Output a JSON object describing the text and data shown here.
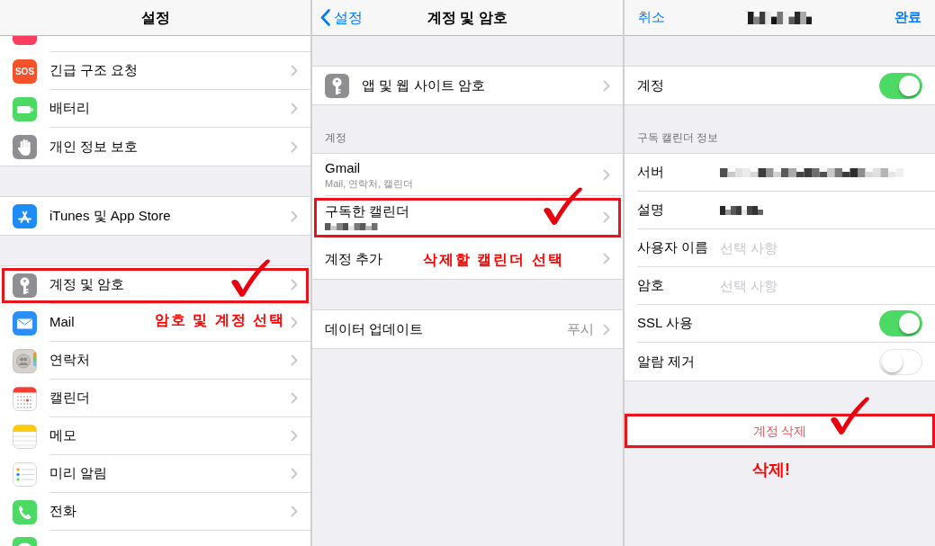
{
  "settings": {
    "title": "설정",
    "groups": [
      {
        "items": [
          {
            "kind": "cut_top"
          },
          {
            "kind": "row",
            "label": "긴급 구조 요청",
            "icon_text": "SOS",
            "marked": false
          },
          {
            "kind": "row",
            "label": "배터리",
            "marked": false
          },
          {
            "kind": "row",
            "label": "개인 정보 보호",
            "marked": false
          }
        ]
      },
      {
        "items": [
          {
            "kind": "row",
            "label": "iTunes 및 App Store",
            "marked": false
          }
        ]
      },
      {
        "items": [
          {
            "kind": "row",
            "label": "계정 및 암호",
            "marked": true
          },
          {
            "kind": "row",
            "label": "Mail",
            "marked": false
          },
          {
            "kind": "row",
            "label": "연락처",
            "marked": false
          },
          {
            "kind": "row",
            "label": "캘린더",
            "marked": false
          },
          {
            "kind": "row",
            "label": "메모",
            "marked": false
          },
          {
            "kind": "row",
            "label": "미리 알림",
            "marked": false
          },
          {
            "kind": "row",
            "label": "전화",
            "marked": false
          },
          {
            "kind": "cut_bottom"
          }
        ]
      }
    ],
    "note": "암호 및 계정 선택"
  },
  "accounts": {
    "back": "설정",
    "title": "계정 및 암호",
    "groups": [
      {
        "items": [
          {
            "kind": "icon_row",
            "label": "앱 및 웹 사이트 암호",
            "marked": false
          }
        ]
      },
      {
        "header": "계정",
        "items": [
          {
            "kind": "account",
            "label": "Gmail",
            "detail": "Mail, 연락처, 캘린더",
            "redacted": false,
            "marked": false
          },
          {
            "kind": "account",
            "label": "구독한 캘린더",
            "redacted": true,
            "marked": true
          },
          {
            "kind": "plain",
            "label": "계정 추가",
            "marked": false
          }
        ]
      },
      {
        "items": [
          {
            "kind": "value",
            "label": "데이터 업데이트",
            "value": "푸시",
            "marked": false
          }
        ]
      }
    ],
    "note": "삭제할 캘린더 선택"
  },
  "subscribed_calendar": {
    "cancel": "취소",
    "title_redacted": true,
    "done": "완료",
    "groups": [
      {
        "items": [
          {
            "kind": "toggle",
            "label": "계정",
            "on": true
          }
        ]
      },
      {
        "header": "구독 캘린더 정보",
        "items": [
          {
            "kind": "field",
            "label": "서버",
            "redacted": true
          },
          {
            "kind": "field",
            "label": "설명",
            "redacted": true
          },
          {
            "kind": "field",
            "label": "사용자 이름",
            "placeholder": "선택 사항",
            "redacted": false
          },
          {
            "kind": "field",
            "label": "암호",
            "placeholder": "선택 사항",
            "redacted": false
          },
          {
            "kind": "toggle",
            "label": "SSL 사용",
            "on": true
          },
          {
            "kind": "toggle",
            "label": "알람 제거",
            "on": false
          }
        ]
      }
    ],
    "delete_button": {
      "label": "계정 삭제",
      "marked": true
    },
    "note": "삭제!"
  }
}
